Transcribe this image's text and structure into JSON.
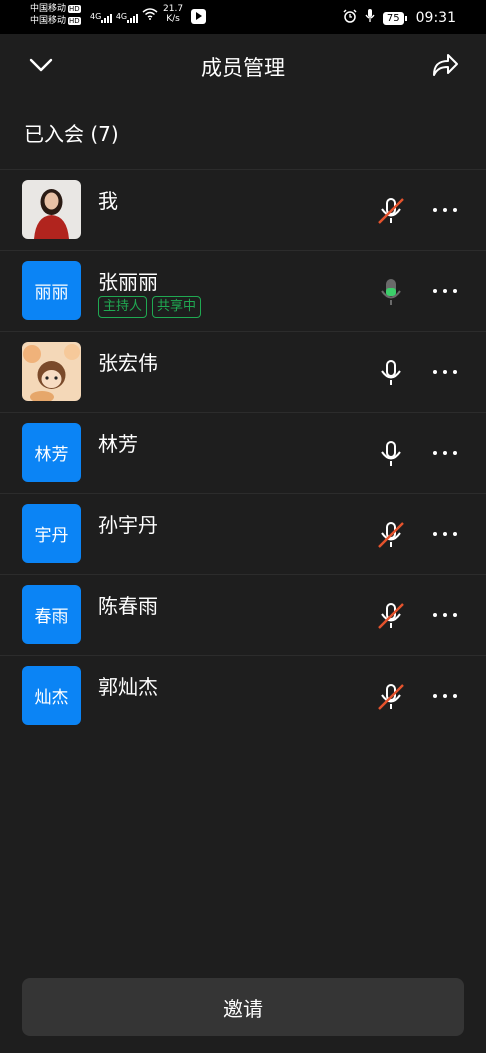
{
  "status_bar": {
    "carrier_1": "中国移动",
    "carrier_2": "中国移动",
    "hd_badge": "HD",
    "network_1": "4G",
    "network_2": "4G",
    "speed_value": "21.7",
    "speed_unit": "K/s",
    "battery": "75",
    "time": "09:31"
  },
  "header": {
    "title": "成员管理"
  },
  "section": {
    "title": "已入会 (7)"
  },
  "members": [
    {
      "name": "我",
      "avatar_text": "",
      "avatar_type": "photo",
      "mic": "muted",
      "tags": []
    },
    {
      "name": "张丽丽",
      "avatar_text": "丽丽",
      "avatar_type": "text",
      "mic": "active",
      "tags": [
        "主持人",
        "共享中"
      ]
    },
    {
      "name": "张宏伟",
      "avatar_text": "",
      "avatar_type": "cartoon",
      "mic": "on",
      "tags": []
    },
    {
      "name": "林芳",
      "avatar_text": "林芳",
      "avatar_type": "text",
      "mic": "on",
      "tags": []
    },
    {
      "name": "孙宇丹",
      "avatar_text": "宇丹",
      "avatar_type": "text",
      "mic": "muted",
      "tags": []
    },
    {
      "name": "陈春雨",
      "avatar_text": "春雨",
      "avatar_type": "text",
      "mic": "muted",
      "tags": []
    },
    {
      "name": "郭灿杰",
      "avatar_text": "灿杰",
      "avatar_type": "text",
      "mic": "muted",
      "tags": []
    }
  ],
  "footer": {
    "invite_label": "邀请"
  },
  "colors": {
    "accent_blue": "#0b84f5",
    "tag_green": "#20a952",
    "mute_red": "#e5532d",
    "mic_active_green": "#3ccf6a"
  }
}
